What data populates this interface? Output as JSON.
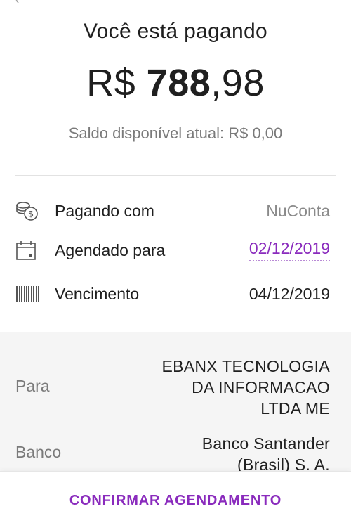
{
  "header": {
    "title": "Você está pagando",
    "amount_currency": "R$ ",
    "amount_integer": "788",
    "amount_decimal": ",98",
    "balance_text": "Saldo disponível atual: R$ 0,00"
  },
  "details": [
    {
      "icon": "coins-icon",
      "label": "Pagando com",
      "value": "NuConta"
    },
    {
      "icon": "calendar-icon",
      "label": "Agendado para",
      "value": "02/12/2019"
    },
    {
      "icon": "barcode-icon",
      "label": "Vencimento",
      "value": "04/12/2019"
    }
  ],
  "recipient": {
    "para_label": "Para",
    "para_lines": [
      "EBANX TECNOLOGIA",
      "DA INFORMACAO",
      "LTDA ME"
    ],
    "banco_label": "Banco",
    "banco_lines": [
      "Banco Santander",
      "(Brasil) S. A."
    ]
  },
  "actions": {
    "confirm_label": "CONFIRMAR AGENDAMENTO"
  },
  "colors": {
    "accent": "#8a2bbd",
    "muted_text": "#7a7a7a",
    "panel_bg": "#f5f5f5"
  }
}
